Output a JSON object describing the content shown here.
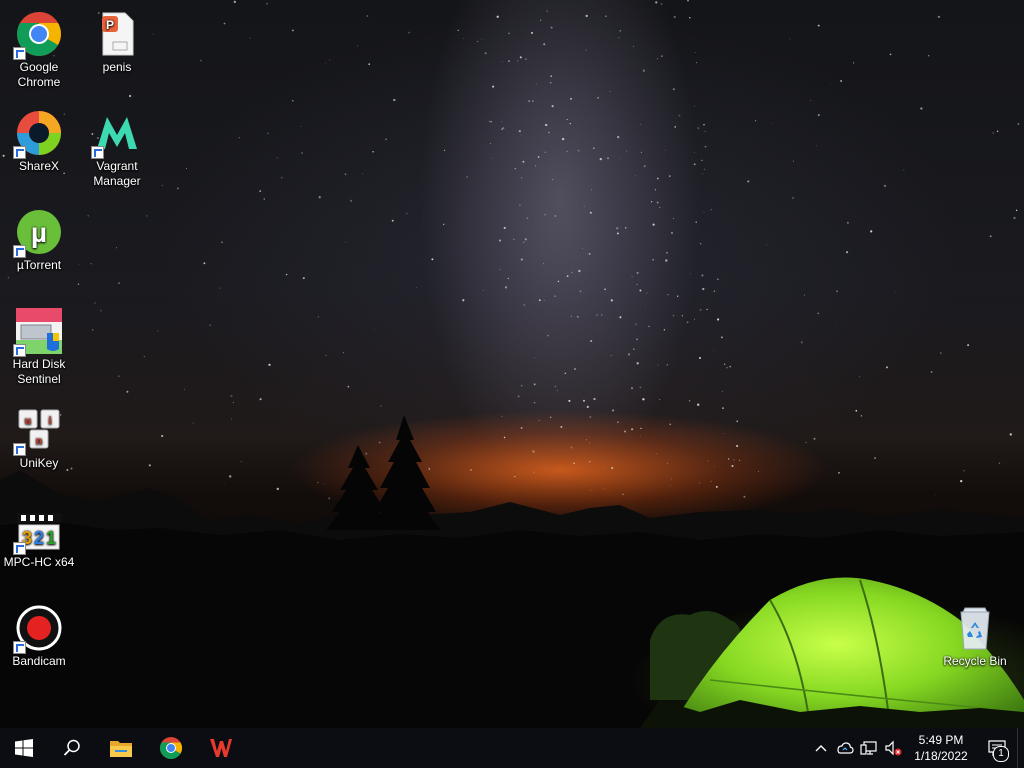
{
  "desktop": {
    "icons": [
      {
        "id": "chrome",
        "label": "Google Chrome",
        "icon": "chrome-icon"
      },
      {
        "id": "penis",
        "label": "penis",
        "icon": "wps-presentation-file-icon"
      },
      {
        "id": "sharex",
        "label": "ShareX",
        "icon": "sharex-icon"
      },
      {
        "id": "vagrant",
        "label": "Vagrant Manager",
        "icon": "vagrant-manager-icon"
      },
      {
        "id": "utorrent",
        "label": "µTorrent",
        "icon": "utorrent-icon"
      },
      {
        "id": "hds",
        "label": "Hard Disk Sentinel",
        "icon": "hard-disk-sentinel-icon"
      },
      {
        "id": "unikey",
        "label": "UniKey",
        "icon": "unikey-icon"
      },
      {
        "id": "mpc",
        "label": "MPC-HC x64",
        "icon": "mpc-hc-icon"
      },
      {
        "id": "bandicam",
        "label": "Bandicam",
        "icon": "bandicam-icon"
      },
      {
        "id": "recycle",
        "label": "Recycle Bin",
        "icon": "recycle-bin-icon"
      }
    ]
  },
  "taskbar": {
    "pinned": [
      "start-icon",
      "search-icon",
      "file-explorer-icon",
      "chrome-icon",
      "wps-office-icon"
    ],
    "tray": {
      "icons": [
        "chevron-up-icon",
        "onedrive-icon",
        "network-icon",
        "volume-muted-icon"
      ],
      "time": "5:49 PM",
      "date": "1/18/2022",
      "notification_count": "1"
    }
  },
  "colors": {
    "taskbar": "#0b0d12",
    "tent_green": "#7ed321",
    "horizon_orange": "#ff6a1a",
    "bandicam_red": "#e52222"
  }
}
